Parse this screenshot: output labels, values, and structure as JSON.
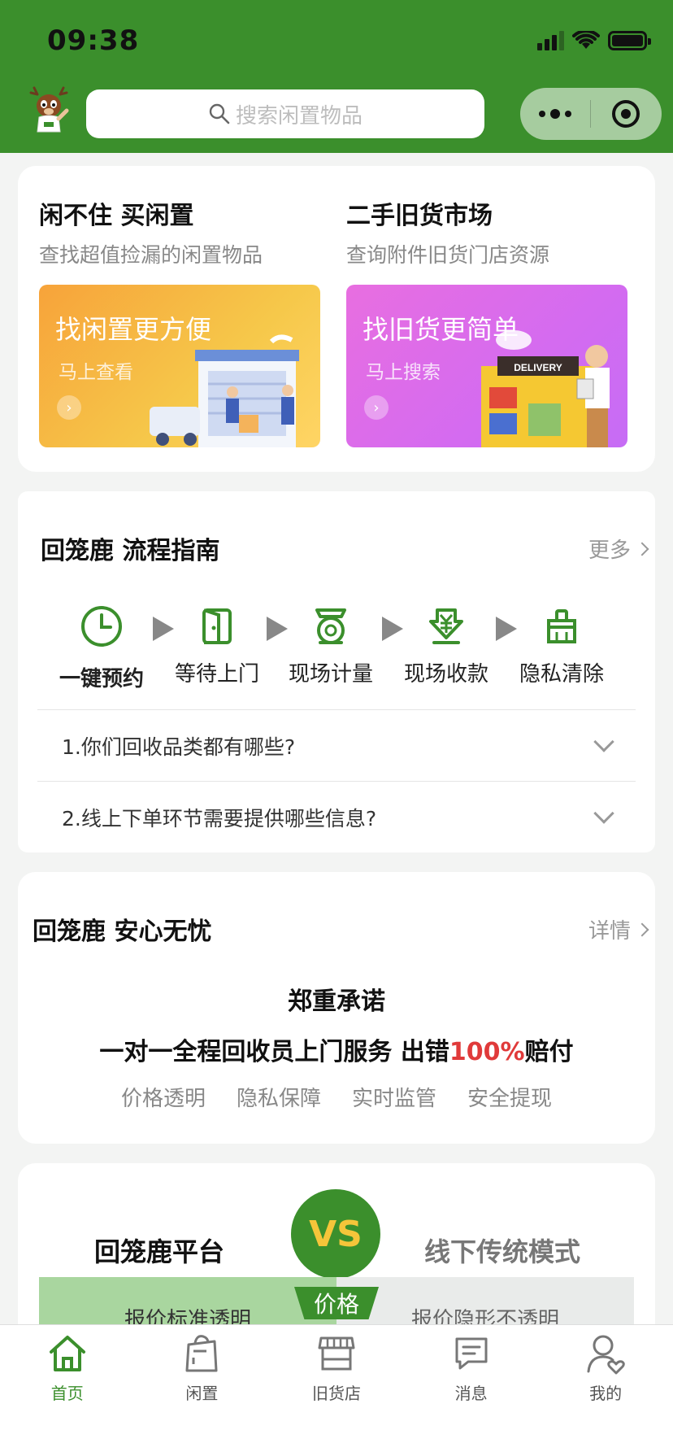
{
  "status_bar": {
    "time": "09:38"
  },
  "header": {
    "search_placeholder": "搜索闲置物品"
  },
  "intro": {
    "left": {
      "title": "闲不住 买闲置",
      "subtitle": "查找超值捡漏的闲置物品",
      "banner_title": "找闲置更方便",
      "banner_sub": "马上查看"
    },
    "right": {
      "title": "二手旧货市场",
      "subtitle": "查询附件旧货门店资源",
      "banner_title": "找旧货更简单",
      "banner_sub": "马上搜索",
      "delivery_sign": "DELIVERY"
    }
  },
  "guide": {
    "title": "回笼鹿 流程指南",
    "more": "更多",
    "steps": [
      "一键预约",
      "等待上门",
      "现场计量",
      "现场收款",
      "隐私清除"
    ],
    "faqs": [
      "1.你们回收品类都有哪些?",
      "2.线上下单环节需要提供哪些信息?"
    ]
  },
  "assurance": {
    "title": "回笼鹿 安心无忧",
    "more": "详情",
    "headline": "郑重承诺",
    "line_a": "一对一全程回收员上门服务 出错",
    "line_red": "100%",
    "line_b": "赔付",
    "features": [
      "价格透明",
      "隐私保障",
      "实时监管",
      "安全提现"
    ]
  },
  "compare": {
    "left": "回笼鹿平台",
    "vs": "VS",
    "right": "线下传统模式",
    "tag": "价格",
    "row_left": "报价标准透明",
    "row_right": "报价隐形不透明"
  },
  "tabs": [
    {
      "label": "首页",
      "icon": "home-icon"
    },
    {
      "label": "闲置",
      "icon": "bag-icon"
    },
    {
      "label": "旧货店",
      "icon": "store-icon"
    },
    {
      "label": "消息",
      "icon": "message-icon"
    },
    {
      "label": "我的",
      "icon": "profile-icon"
    }
  ],
  "colors": {
    "brand": "#3b8f2c",
    "accent_red": "#e03a3a",
    "vs_yellow": "#f5c53a"
  }
}
